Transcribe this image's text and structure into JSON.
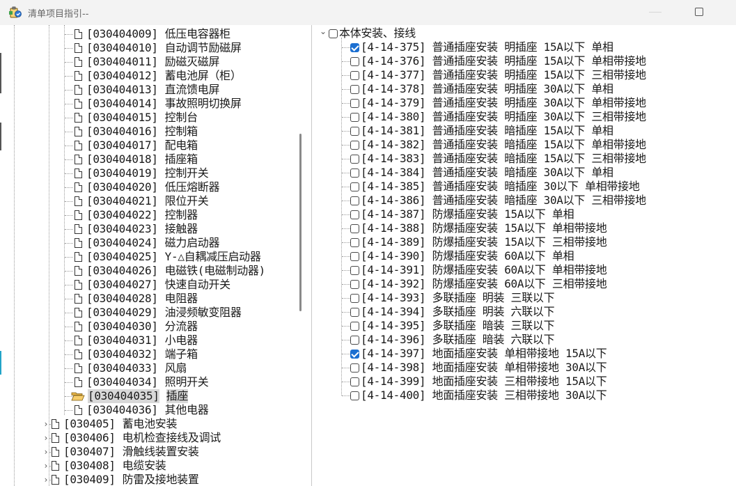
{
  "window": {
    "title": "清单项目指引--",
    "icons": {
      "app": "clipboard-icon",
      "minimize": "minimize-icon",
      "maximize": "maximize-icon"
    }
  },
  "left_tree": {
    "items": [
      {
        "code": "[030404009]",
        "label": "低压电容器柜",
        "icon": "document-icon"
      },
      {
        "code": "[030404010]",
        "label": "自动调节励磁屏",
        "icon": "document-icon"
      },
      {
        "code": "[030404011]",
        "label": "励磁灭磁屏",
        "icon": "document-icon"
      },
      {
        "code": "[030404012]",
        "label": "蓄电池屏（柜）",
        "icon": "document-icon"
      },
      {
        "code": "[030404013]",
        "label": "直流馈电屏",
        "icon": "document-icon"
      },
      {
        "code": "[030404014]",
        "label": "事故照明切换屏",
        "icon": "document-icon"
      },
      {
        "code": "[030404015]",
        "label": "控制台",
        "icon": "document-icon"
      },
      {
        "code": "[030404016]",
        "label": "控制箱",
        "icon": "document-icon"
      },
      {
        "code": "[030404017]",
        "label": "配电箱",
        "icon": "document-icon"
      },
      {
        "code": "[030404018]",
        "label": "插座箱",
        "icon": "document-icon"
      },
      {
        "code": "[030404019]",
        "label": "控制开关",
        "icon": "document-icon"
      },
      {
        "code": "[030404020]",
        "label": "低压熔断器",
        "icon": "document-icon"
      },
      {
        "code": "[030404021]",
        "label": "限位开关",
        "icon": "document-icon"
      },
      {
        "code": "[030404022]",
        "label": "控制器",
        "icon": "document-icon"
      },
      {
        "code": "[030404023]",
        "label": "接触器",
        "icon": "document-icon"
      },
      {
        "code": "[030404024]",
        "label": "磁力启动器",
        "icon": "document-icon"
      },
      {
        "code": "[030404025]",
        "label": "Y-△自耦减压启动器",
        "icon": "document-icon"
      },
      {
        "code": "[030404026]",
        "label": "电磁铁(电磁制动器)",
        "icon": "document-icon"
      },
      {
        "code": "[030404027]",
        "label": "快速自动开关",
        "icon": "document-icon"
      },
      {
        "code": "[030404028]",
        "label": "电阻器",
        "icon": "document-icon"
      },
      {
        "code": "[030404029]",
        "label": "油浸频敏变阻器",
        "icon": "document-icon"
      },
      {
        "code": "[030404030]",
        "label": "分流器",
        "icon": "document-icon"
      },
      {
        "code": "[030404031]",
        "label": "小电器",
        "icon": "document-icon"
      },
      {
        "code": "[030404032]",
        "label": "端子箱",
        "icon": "document-icon"
      },
      {
        "code": "[030404033]",
        "label": "风扇",
        "icon": "document-icon"
      },
      {
        "code": "[030404034]",
        "label": "照明开关",
        "icon": "document-icon"
      },
      {
        "code": "[030404035]",
        "label": "插座",
        "icon": "open-folder-icon",
        "selected": true
      },
      {
        "code": "[030404036]",
        "label": "其他电器",
        "icon": "document-icon"
      }
    ],
    "groups": [
      {
        "code": "[030405]",
        "label": "蓄电池安装",
        "icon": "document-icon",
        "expander": "expand-arrow-icon"
      },
      {
        "code": "[030406]",
        "label": "电机检查接线及调试",
        "icon": "document-icon",
        "expander": "expand-arrow-icon"
      },
      {
        "code": "[030407]",
        "label": "滑触线装置安装",
        "icon": "document-icon",
        "expander": "expand-arrow-icon"
      },
      {
        "code": "[030408]",
        "label": "电缆安装",
        "icon": "document-icon",
        "expander": "expand-arrow-icon"
      },
      {
        "code": "[030409]",
        "label": "防雷及接地装置",
        "icon": "document-icon",
        "expander": "expand-arrow-icon"
      }
    ]
  },
  "right_tree": {
    "root": {
      "label": "本体安装、接线",
      "checked": false,
      "expander": "collapse-arrow-icon"
    },
    "items": [
      {
        "text": "[4-14-375] 普通插座安装 明插座 15A以下 单相",
        "checked": true
      },
      {
        "text": "[4-14-376] 普通插座安装 明插座 15A以下 单相带接地",
        "checked": false
      },
      {
        "text": "[4-14-377] 普通插座安装 明插座 15A以下 三相带接地",
        "checked": false
      },
      {
        "text": "[4-14-378] 普通插座安装 明插座 30A以下 单相",
        "checked": false
      },
      {
        "text": "[4-14-379] 普通插座安装 明插座 30A以下 单相带接地",
        "checked": false
      },
      {
        "text": "[4-14-380] 普通插座安装 明插座 30A以下 三相带接地",
        "checked": false
      },
      {
        "text": "[4-14-381] 普通插座安装 暗插座 15A以下 单相",
        "checked": false
      },
      {
        "text": "[4-14-382] 普通插座安装 暗插座 15A以下 单相带接地",
        "checked": false
      },
      {
        "text": "[4-14-383] 普通插座安装 暗插座 15A以下 三相带接地",
        "checked": false
      },
      {
        "text": "[4-14-384] 普通插座安装 暗插座 30A以下 单相",
        "checked": false
      },
      {
        "text": "[4-14-385] 普通插座安装 暗插座 30以下 单相带接地",
        "checked": false
      },
      {
        "text": "[4-14-386] 普通插座安装 暗插座 30A以下 三相带接地",
        "checked": false
      },
      {
        "text": "[4-14-387] 防爆插座安装 15A以下 单相",
        "checked": false
      },
      {
        "text": "[4-14-388] 防爆插座安装 15A以下 单相带接地",
        "checked": false
      },
      {
        "text": "[4-14-389] 防爆插座安装 15A以下 三相带接地",
        "checked": false
      },
      {
        "text": "[4-14-390] 防爆插座安装 60A以下 单相",
        "checked": false
      },
      {
        "text": "[4-14-391] 防爆插座安装 60A以下 单相带接地",
        "checked": false
      },
      {
        "text": "[4-14-392] 防爆插座安装 60A以下 三相带接地",
        "checked": false
      },
      {
        "text": "[4-14-393] 多联插座 明装 三联以下",
        "checked": false
      },
      {
        "text": "[4-14-394] 多联插座 明装 六联以下",
        "checked": false
      },
      {
        "text": "[4-14-395] 多联插座 暗装 三联以下",
        "checked": false
      },
      {
        "text": "[4-14-396] 多联插座 暗装 六联以下",
        "checked": false
      },
      {
        "text": "[4-14-397] 地面插座安装 单相带接地 15A以下",
        "checked": true
      },
      {
        "text": "[4-14-398] 地面插座安装 单相带接地 30A以下",
        "checked": false
      },
      {
        "text": "[4-14-399] 地面插座安装 三相带接地 15A以下",
        "checked": false
      },
      {
        "text": "[4-14-400] 地面插座安装 三相带接地 30A以下",
        "checked": false
      }
    ]
  },
  "colors": {
    "accent": "#1c6fd1",
    "selection": "#d8d8d8",
    "titlebar": "#f3f3f3",
    "folder": "#e9b64a"
  }
}
